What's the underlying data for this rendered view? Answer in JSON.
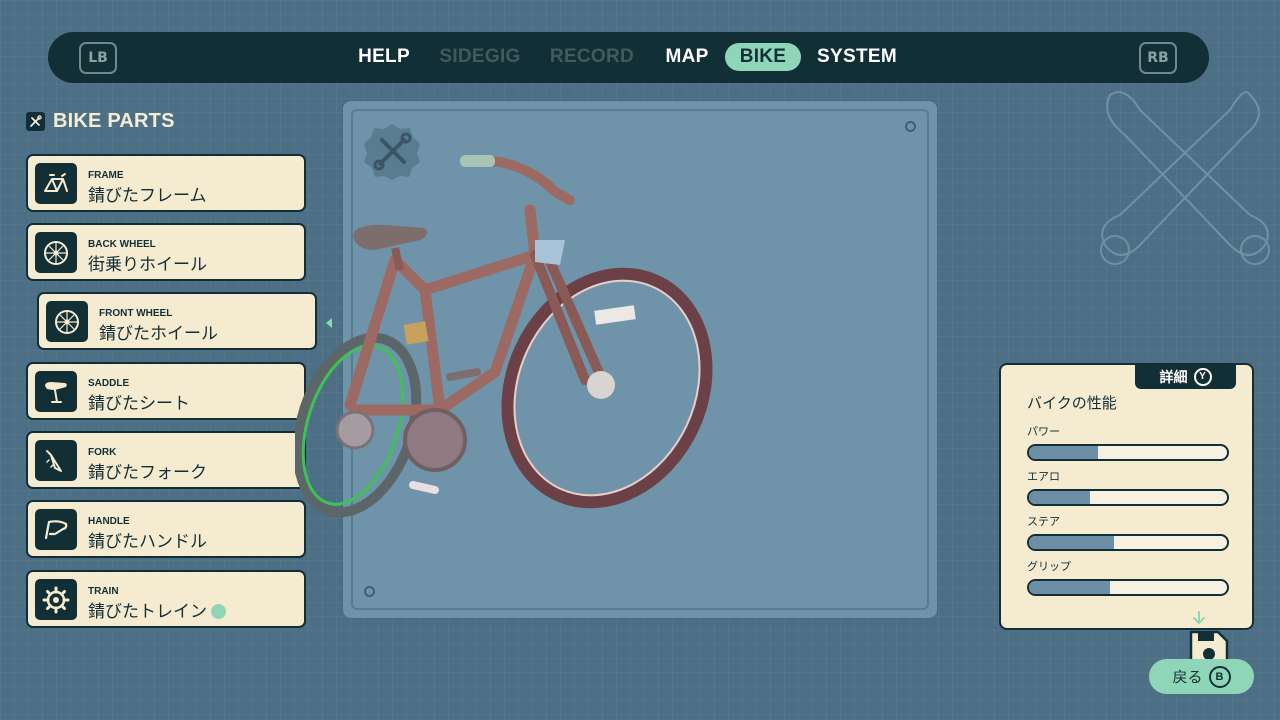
{
  "nav": {
    "left_shoulder": "LB",
    "right_shoulder": "RB",
    "tabs": [
      {
        "label": "HELP",
        "state": "normal"
      },
      {
        "label": "SIDEGIG",
        "state": "dim"
      },
      {
        "label": "RECORD",
        "state": "dim"
      },
      {
        "label": "MAP",
        "state": "normal"
      },
      {
        "label": "BIKE",
        "state": "active"
      },
      {
        "label": "SYSTEM",
        "state": "normal"
      }
    ]
  },
  "parts": {
    "header": "BIKE PARTS",
    "header_icon": "wrench-screwdriver-icon",
    "items": [
      {
        "type": "FRAME",
        "name": "錆びたフレーム",
        "icon": "frame-icon",
        "selected": false
      },
      {
        "type": "BACK WHEEL",
        "name": "街乗りホイール",
        "icon": "wheel-icon",
        "selected": false
      },
      {
        "type": "FRONT WHEEL",
        "name": "錆びたホイール",
        "icon": "wheel-icon",
        "selected": true
      },
      {
        "type": "SADDLE",
        "name": "錆びたシート",
        "icon": "saddle-icon",
        "selected": false
      },
      {
        "type": "FORK",
        "name": "錆びたフォーク",
        "icon": "fork-icon",
        "selected": false
      },
      {
        "type": "HANDLE",
        "name": "錆びたハンドル",
        "icon": "handle-icon",
        "selected": false
      },
      {
        "type": "TRAIN",
        "name": "錆びたトレイン",
        "icon": "gear-icon",
        "selected": false,
        "badge": true
      }
    ]
  },
  "stats": {
    "tab_label": "詳細",
    "tab_button": "Y",
    "title": "バイクの性能",
    "items": [
      {
        "label": "パワー",
        "value": 0.35
      },
      {
        "label": "エアロ",
        "value": 0.31
      },
      {
        "label": "ステア",
        "value": 0.43
      },
      {
        "label": "グリップ",
        "value": 0.41
      }
    ]
  },
  "back": {
    "label": "戻る",
    "button": "B"
  },
  "colors": {
    "background": "#4d6f85",
    "nav_bg": "#132f36",
    "accent": "#8fd6b8",
    "card_bg": "#f5ebd1",
    "stat_fill": "#6d8fa6"
  }
}
